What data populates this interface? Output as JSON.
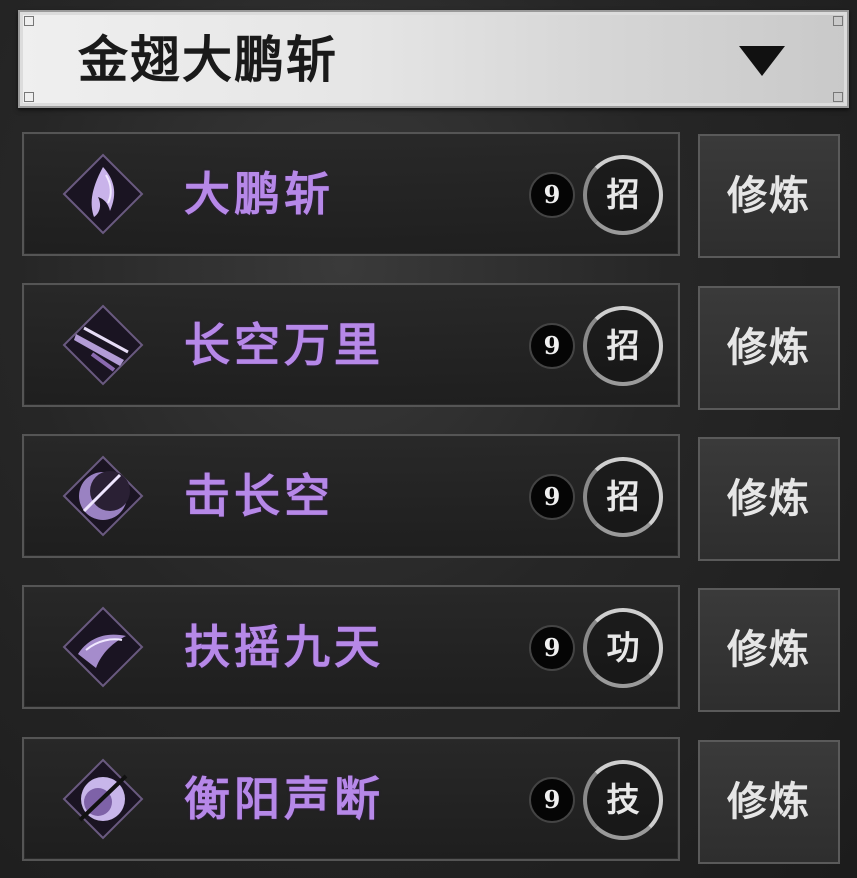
{
  "header": {
    "title": "金翅大鹏斩"
  },
  "skills": [
    {
      "name": "大鹏斩",
      "level": "9",
      "type": "招",
      "action": "修炼",
      "icon": "feather-flame-icon"
    },
    {
      "name": "长空万里",
      "level": "9",
      "type": "招",
      "action": "修炼",
      "icon": "wing-slash-icon"
    },
    {
      "name": "击长空",
      "level": "9",
      "type": "招",
      "action": "修炼",
      "icon": "crescent-strike-icon"
    },
    {
      "name": "扶摇九天",
      "level": "9",
      "type": "功",
      "action": "修炼",
      "icon": "rising-wind-icon"
    },
    {
      "name": "衡阳声断",
      "level": "9",
      "type": "技",
      "action": "修炼",
      "icon": "moon-break-icon"
    }
  ],
  "colors": {
    "skill_name": "#b688e8",
    "icon_purple": "#8a6ab0"
  }
}
